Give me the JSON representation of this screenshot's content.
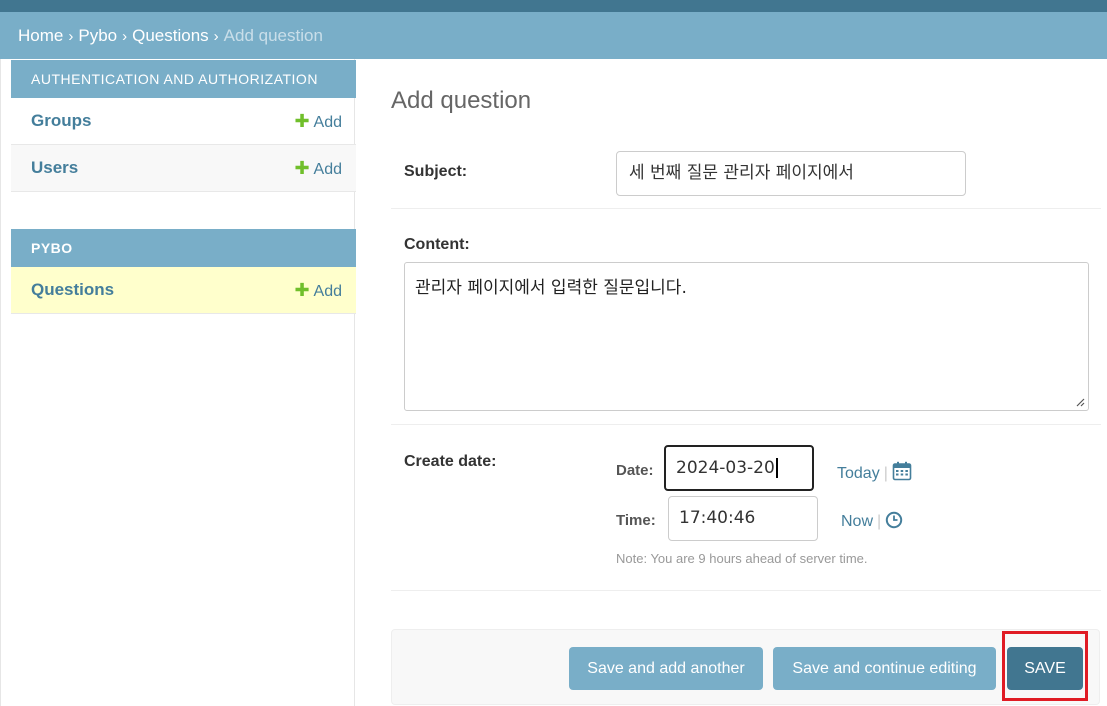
{
  "breadcrumbs": {
    "home": "Home",
    "app": "Pybo",
    "model": "Questions",
    "current": "Add question",
    "separator": "›"
  },
  "sidebar": {
    "auth_header": "AUTHENTICATION AND AUTHORIZATION",
    "auth_items": [
      {
        "label": "Groups",
        "add_label": "Add"
      },
      {
        "label": "Users",
        "add_label": "Add"
      }
    ],
    "pybo_header": "PYBO",
    "pybo_items": [
      {
        "label": "Questions",
        "add_label": "Add"
      }
    ],
    "plus_glyph": "✚"
  },
  "main": {
    "title": "Add question",
    "subject": {
      "label": "Subject:",
      "value": "세 번째 질문 관리자 페이지에서"
    },
    "content": {
      "label": "Content:",
      "value": "관리자 페이지에서 입력한 질문입니다."
    },
    "create_date": {
      "label": "Create date:",
      "date_label": "Date:",
      "date_value": "2024-03-20",
      "today_label": "Today",
      "time_label": "Time:",
      "time_value": "17:40:46",
      "now_label": "Now",
      "pipe": "|",
      "note": "Note: You are 9 hours ahead of server time."
    }
  },
  "submit": {
    "save_add_another": "Save and add another",
    "save_continue": "Save and continue editing",
    "save": "SAVE"
  },
  "colors": {
    "header_dark": "#417690",
    "header_light": "#79aec8",
    "link": "#447e9b",
    "add_plus": "#70bf2b",
    "selected_row": "#ffffcc",
    "highlight": "#e01b24"
  }
}
